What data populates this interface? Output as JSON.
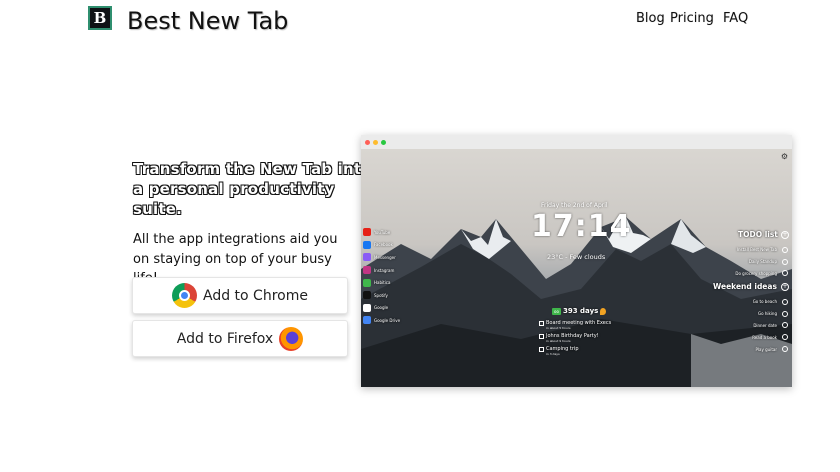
{
  "header": {
    "logo_letter": "B",
    "brand": "Best New Tab",
    "nav": [
      {
        "label": "Blog"
      },
      {
        "label": "Pricing"
      },
      {
        "label": "FAQ"
      }
    ]
  },
  "hero": {
    "headline": "Transform the New Tab into a personal productivity suite.",
    "subline": "All the app integrations aid you on staying on top of your busy life!",
    "chrome_button": {
      "label": "Add to Chrome",
      "icon": "chrome-logo-icon"
    },
    "firefox_button": {
      "label": "Add to Firefox",
      "icon": "firefox-logo-icon"
    }
  },
  "preview": {
    "date": "Friday the 2nd of April",
    "clock": "17:14",
    "weather": "23°C - Few clouds",
    "links": [
      {
        "label": "YouTube",
        "color": "#e62117"
      },
      {
        "label": "Facebook",
        "color": "#1877f2"
      },
      {
        "label": "Messenger",
        "color": "#8a5cf6"
      },
      {
        "label": "Instagram",
        "color": "#c13584"
      },
      {
        "label": "Habitica",
        "color": "#3fb64b"
      },
      {
        "label": "Spotify",
        "color": "#111111"
      },
      {
        "label": "Google",
        "color": "#ffffff"
      },
      {
        "label": "Google Drive",
        "color": "#4285f4"
      }
    ],
    "days_count": "393 days",
    "events": [
      {
        "title": "Board meeting with Execs",
        "sub": "in about 5 hours"
      },
      {
        "title": "Johns Birthday Party!",
        "sub": "in about 9 hours"
      },
      {
        "title": "Camping trip",
        "sub": "in 3 days"
      }
    ],
    "todo": {
      "title": "TODO list",
      "items": [
        "Install Best New Tab",
        "Daily Standup",
        "Do grocery shopping"
      ]
    },
    "weekend": {
      "title": "Weekend ideas",
      "items": [
        "Go to beach",
        "Go hiking",
        "Dinner date",
        "Read a book",
        "Play guitar"
      ]
    }
  }
}
